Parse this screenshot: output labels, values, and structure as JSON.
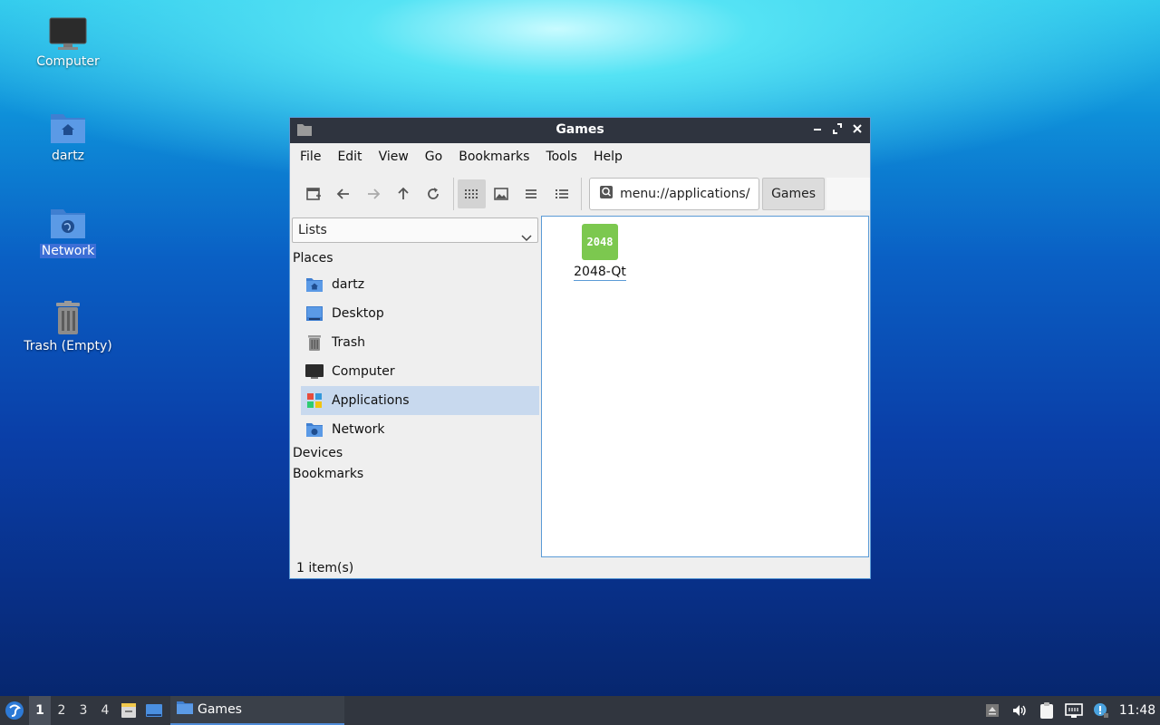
{
  "desktop": {
    "icons": [
      {
        "label": "Computer"
      },
      {
        "label": "dartz"
      },
      {
        "label": "Network"
      },
      {
        "label": "Trash (Empty)"
      }
    ]
  },
  "window": {
    "title": "Games",
    "menu": [
      "File",
      "Edit",
      "View",
      "Go",
      "Bookmarks",
      "Tools",
      "Help"
    ],
    "path": {
      "entry": "menu://applications/",
      "crumb": "Games"
    },
    "sidebar": {
      "combo": "Lists",
      "places_header": "Places",
      "places": [
        "dartz",
        "Desktop",
        "Trash",
        "Computer",
        "Applications",
        "Network"
      ],
      "devices_header": "Devices",
      "bookmarks_header": "Bookmarks"
    },
    "files": [
      {
        "name": "2048-Qt",
        "icon_text": "2048"
      }
    ],
    "status": "1 item(s)"
  },
  "taskbar": {
    "workspaces": [
      "1",
      "2",
      "3",
      "4"
    ],
    "task_label": "Games",
    "clock": "11:48"
  },
  "colors": {
    "accent": "#5b9bd6",
    "titlebar": "#2f343f",
    "taskbar": "#31363f",
    "app_2048": "#7cc84f"
  }
}
